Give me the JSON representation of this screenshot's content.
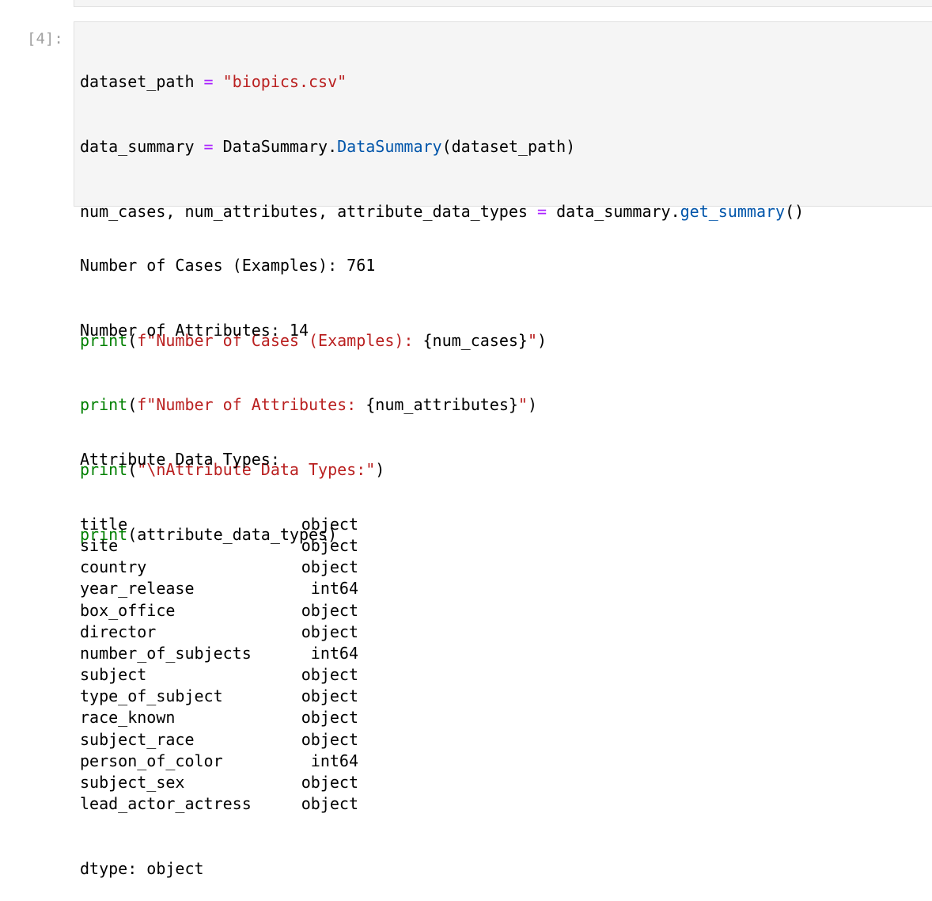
{
  "previous_cell": {},
  "cell": {
    "prompt": "[4]:",
    "code": {
      "line1": {
        "var": "dataset_path",
        "op": "=",
        "str": "\"biopics.csv\""
      },
      "line2": {
        "var": "data_summary",
        "op": "=",
        "module": "DataSummary.",
        "cls": "DataSummary",
        "args": "(dataset_path)"
      },
      "line3": {
        "vars": "num_cases, num_attributes, attribute_data_types",
        "op": "=",
        "obj": "data_summary.",
        "method": "get_summary",
        "args": "()"
      },
      "line5": {
        "fn": "print",
        "open": "(",
        "str": "f\"Number of Cases (Examples): ",
        "interp": "{num_cases}",
        "str_end": "\"",
        "close": ")"
      },
      "line6": {
        "fn": "print",
        "open": "(",
        "str": "f\"Number of Attributes: ",
        "interp": "{num_attributes}",
        "str_end": "\"",
        "close": ")"
      },
      "line7": {
        "fn": "print",
        "open": "(",
        "str": "\"\\nAttribute Data Types:\"",
        "close": ")"
      },
      "line8": {
        "fn": "print",
        "args": "(attribute_data_types)"
      }
    }
  },
  "output": {
    "cases_line": "Number of Cases (Examples): 761",
    "attributes_line": "Number of Attributes: 14",
    "types_header": "Attribute Data Types:",
    "dtypes": [
      {
        "name": "title",
        "type": "object"
      },
      {
        "name": "site",
        "type": "object"
      },
      {
        "name": "country",
        "type": "object"
      },
      {
        "name": "year_release",
        "type": "int64"
      },
      {
        "name": "box_office",
        "type": "object"
      },
      {
        "name": "director",
        "type": "object"
      },
      {
        "name": "number_of_subjects",
        "type": "int64"
      },
      {
        "name": "subject",
        "type": "object"
      },
      {
        "name": "type_of_subject",
        "type": "object"
      },
      {
        "name": "race_known",
        "type": "object"
      },
      {
        "name": "subject_race",
        "type": "object"
      },
      {
        "name": "person_of_color",
        "type": "int64"
      },
      {
        "name": "subject_sex",
        "type": "object"
      },
      {
        "name": "lead_actor_actress",
        "type": "object"
      }
    ],
    "dtype_footer": "dtype: object"
  },
  "colors": {
    "string": "#ba2121",
    "operator": "#aa22ff",
    "builtin": "#008000",
    "attribute": "#0055aa",
    "prompt": "#a0a0a0",
    "cell_background": "#f5f5f5"
  }
}
